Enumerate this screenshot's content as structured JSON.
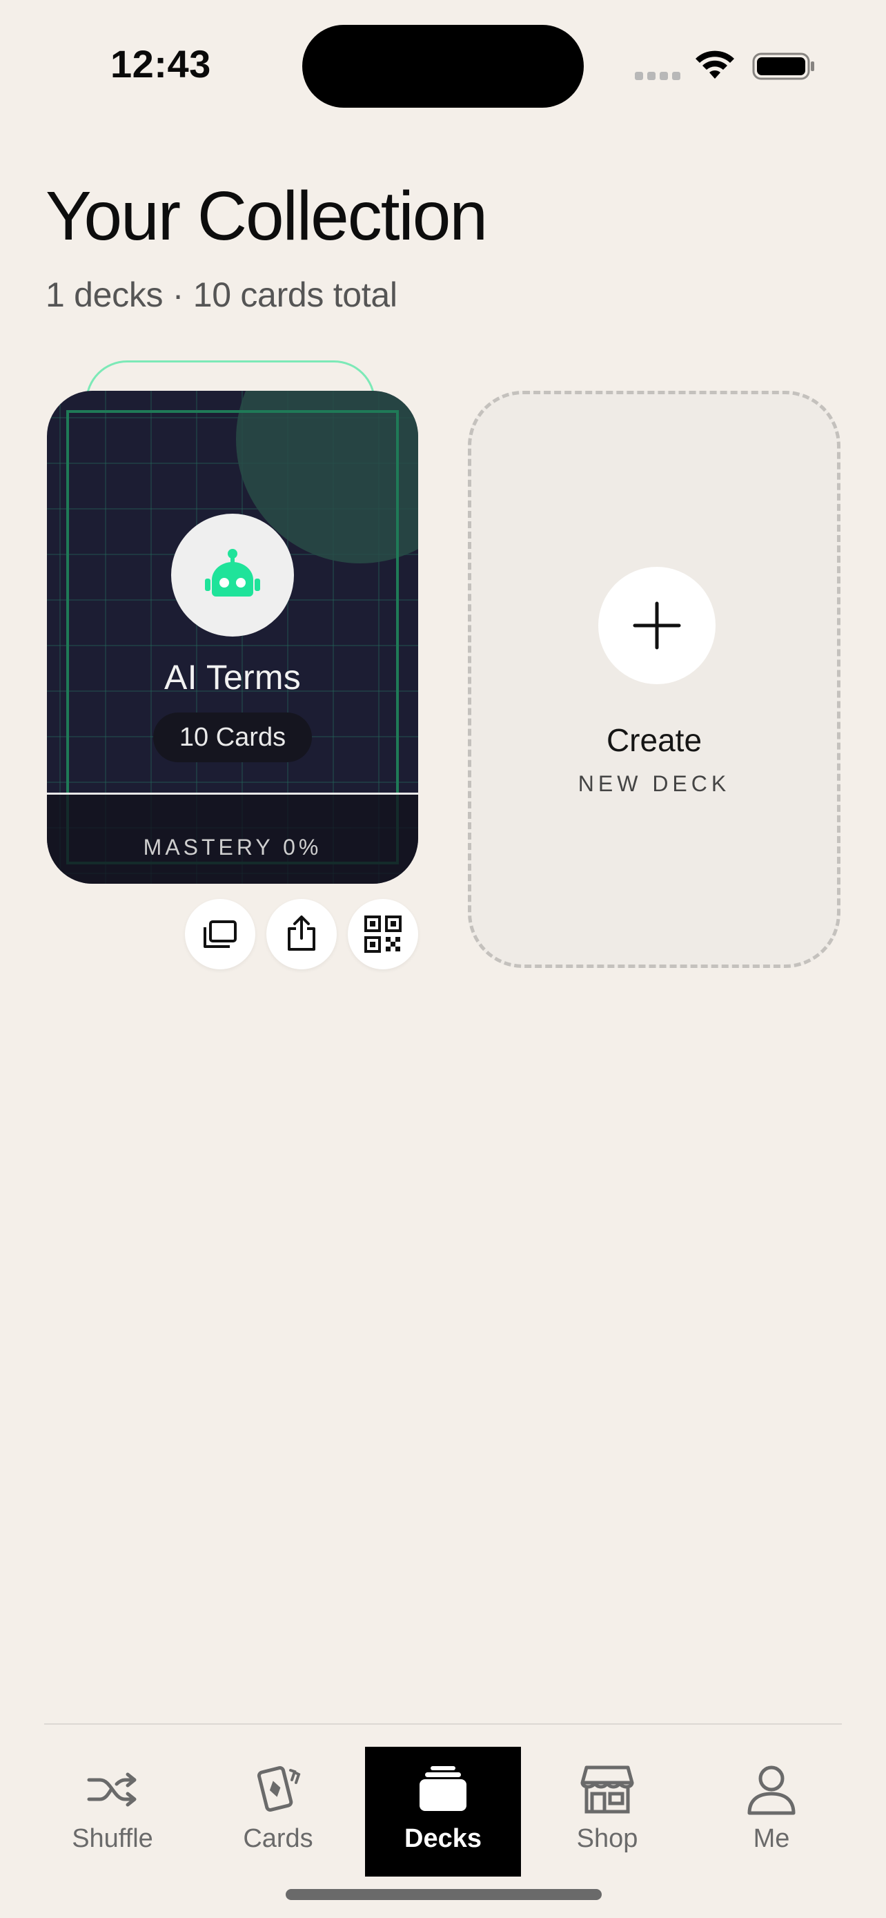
{
  "status_bar": {
    "time": "12:43"
  },
  "header": {
    "title": "Your Collection",
    "subtitle": "1 decks · 10 cards total"
  },
  "deck": {
    "title": "AI Terms",
    "card_count": "10 Cards",
    "mastery": "MASTERY 0%",
    "mastery_value": 0,
    "icon": "robot-icon",
    "accent_color": "#1fe39a",
    "actions": [
      "stack-icon",
      "share-icon",
      "qr-code-icon"
    ]
  },
  "create": {
    "title": "Create",
    "subtitle": "NEW DECK"
  },
  "tabs": [
    {
      "label": "Shuffle",
      "icon": "shuffle-icon",
      "active": false
    },
    {
      "label": "Cards",
      "icon": "cards-icon",
      "active": false
    },
    {
      "label": "Decks",
      "icon": "decks-icon",
      "active": true
    },
    {
      "label": "Shop",
      "icon": "shop-icon",
      "active": false
    },
    {
      "label": "Me",
      "icon": "person-icon",
      "active": false
    }
  ]
}
